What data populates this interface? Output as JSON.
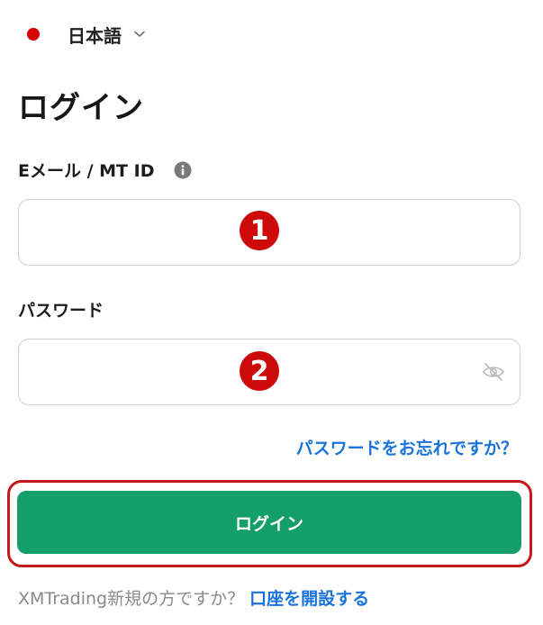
{
  "language": {
    "label": "日本語",
    "flag_color": "#d50000",
    "icon": "chevron-down-icon"
  },
  "page_title": "ログイン",
  "email": {
    "label": "Eメール / MT ID",
    "info_icon": "info-icon",
    "value": "",
    "step_number": "1"
  },
  "password": {
    "label": "パスワード",
    "value": "",
    "toggle_icon": "eye-off-icon",
    "step_number": "2"
  },
  "forgot_password_link": "パスワードをお忘れですか？",
  "login_button_label": "ログイン",
  "signup": {
    "prompt": "XMTrading新規の方ですか？",
    "link": "口座を開設する"
  },
  "colors": {
    "primary_button": "#139e6a",
    "link": "#1a73d9",
    "annotation_red": "#c8161d"
  }
}
